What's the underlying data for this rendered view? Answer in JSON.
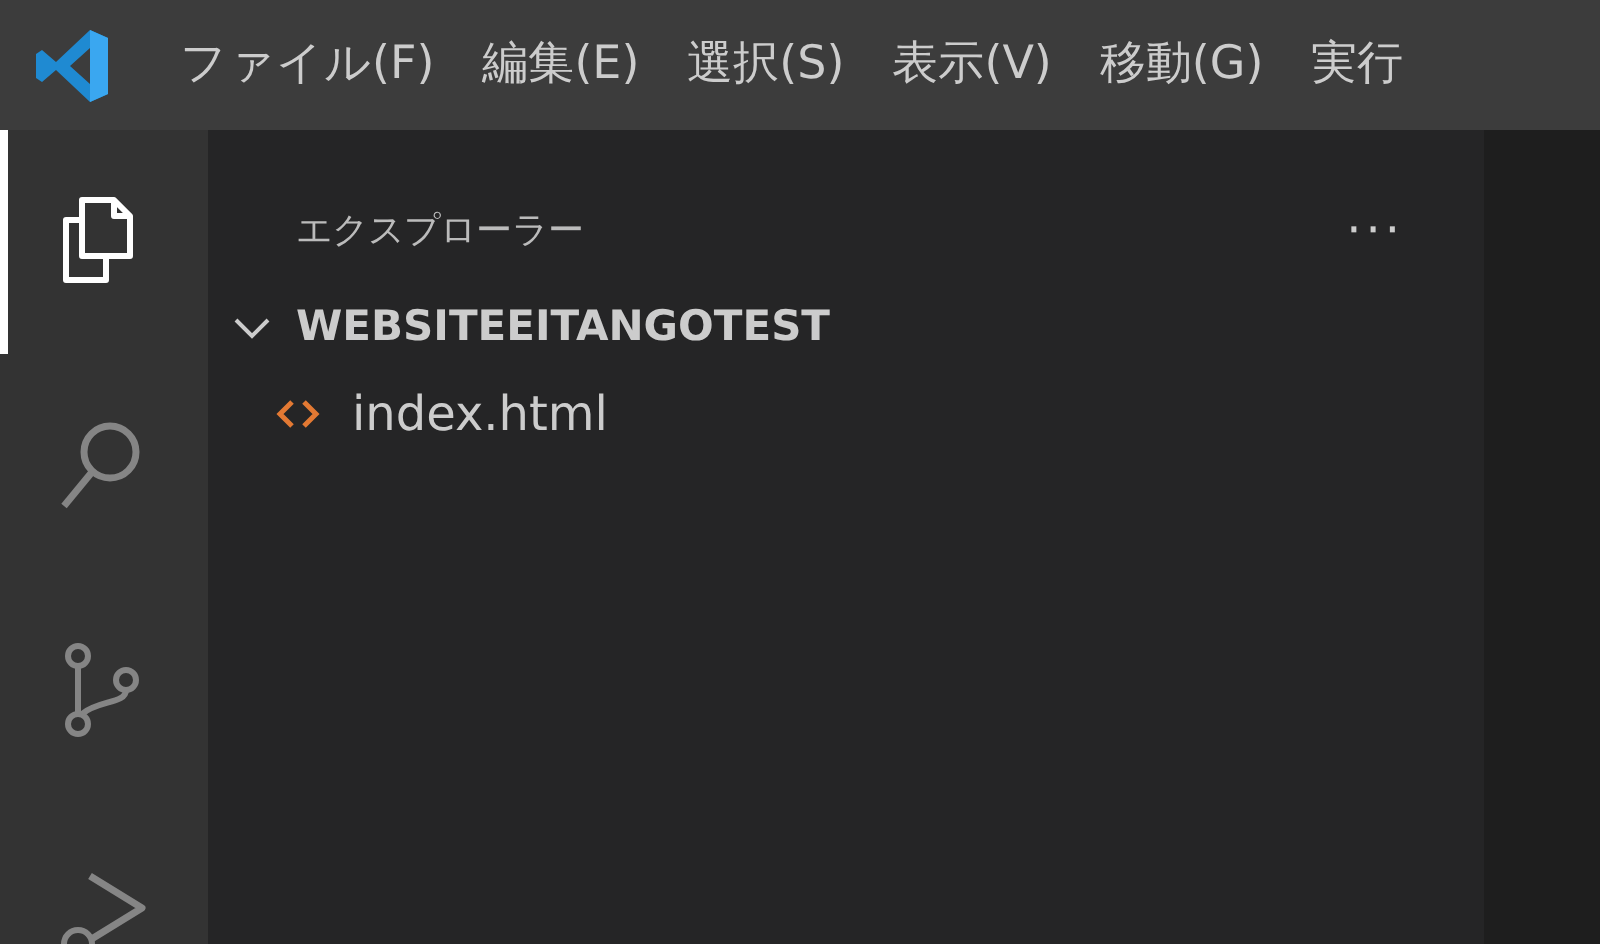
{
  "menu": [
    "ファイル(F)",
    "編集(E)",
    "選択(S)",
    "表示(V)",
    "移動(G)",
    "実行"
  ],
  "activity_bar": [
    {
      "kind": "files",
      "selected": true
    },
    {
      "kind": "search",
      "selected": false
    },
    {
      "kind": "branch",
      "selected": false
    },
    {
      "kind": "run",
      "selected": false
    }
  ],
  "sidebar": {
    "title": "エクスプローラー",
    "more": "···",
    "folder": {
      "name": "WEBSITEEITANGOTEST",
      "expanded": true,
      "children": [
        {
          "name": "index.html"
        }
      ]
    }
  }
}
